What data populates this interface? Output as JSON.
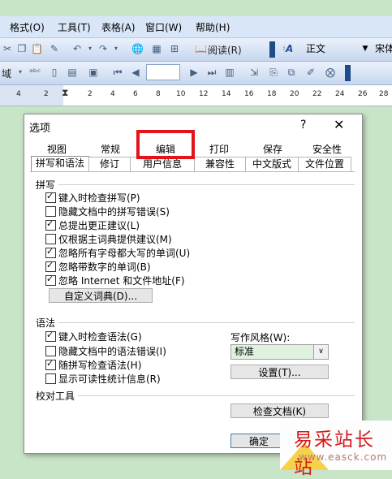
{
  "menubar": {
    "items": [
      "格式(O)",
      "工具(T)",
      "表格(A)",
      "窗口(W)",
      "帮助(H)"
    ]
  },
  "toolbar1": {
    "reading_label": "阅读(R)",
    "style_value": "正文",
    "font_value": "宋体",
    "style_icon_label": "A"
  },
  "toolbar2": {
    "field_label": "域",
    "page_input": ""
  },
  "ruler": {
    "numbers": [
      "4",
      "2",
      "",
      "2",
      "4",
      "6",
      "8",
      "10",
      "12",
      "14",
      "16",
      "18",
      "20",
      "22",
      "24",
      "26",
      "28"
    ]
  },
  "dialog": {
    "title": "选项",
    "help": "?",
    "close": "✕",
    "tabs_back": [
      "视图",
      "常规",
      "编辑",
      "打印",
      "保存",
      "安全性"
    ],
    "tabs_front": [
      "拼写和语法",
      "修订",
      "用户信息",
      "兼容性",
      "中文版式",
      "文件位置"
    ],
    "active_tab": "拼写和语法",
    "spelling": {
      "header": "拼写",
      "options": [
        {
          "label": "键入时检查拼写(P)",
          "checked": true
        },
        {
          "label": "隐藏文档中的拼写错误(S)",
          "checked": false
        },
        {
          "label": "总提出更正建议(L)",
          "checked": true
        },
        {
          "label": "仅根据主词典提供建议(M)",
          "checked": false
        },
        {
          "label": "忽略所有字母都大写的单词(U)",
          "checked": true
        },
        {
          "label": "忽略带数字的单词(B)",
          "checked": true
        },
        {
          "label": "忽略 Internet 和文件地址(F)",
          "checked": true
        }
      ],
      "custom_dict_button": "自定义词典(D)..."
    },
    "grammar": {
      "header": "语法",
      "options": [
        {
          "label": "键入时检查语法(G)",
          "checked": true
        },
        {
          "label": "隐藏文档中的语法错误(I)",
          "checked": false
        },
        {
          "label": "随拼写检查语法(H)",
          "checked": true
        },
        {
          "label": "显示可读性统计信息(R)",
          "checked": false
        }
      ],
      "writing_style_label": "写作风格(W):",
      "writing_style_value": "标准",
      "settings_button": "设置(T)..."
    },
    "proofing": {
      "header": "校对工具",
      "check_doc_button": "检查文档(K)"
    },
    "ok_button": "确定"
  },
  "watermark": {
    "text": "易采站长站",
    "url": "www.easck.com"
  },
  "colors": {
    "highlight": "#e3131b",
    "dialog_bg": "#ffffff",
    "doc_bg": "#c9e5c8",
    "toolbar_bg": "#d9e6f8"
  }
}
